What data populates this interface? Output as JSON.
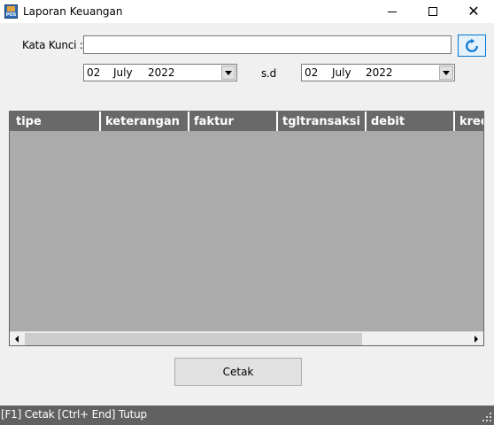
{
  "window": {
    "title": "Laporan Keuangan",
    "icon_text": "POS"
  },
  "form": {
    "keyword_label": "Kata Kunci :",
    "keyword_value": "",
    "sd_label": "s.d",
    "date_from": {
      "day": "02",
      "month": "July",
      "year": "2022"
    },
    "date_to": {
      "day": "02",
      "month": "July",
      "year": "2022"
    }
  },
  "grid": {
    "columns": [
      "tipe",
      "keterangan",
      "faktur",
      "tgltransaksi",
      "debit",
      "kredit"
    ],
    "rows": []
  },
  "actions": {
    "print_label": "Cetak"
  },
  "status": {
    "text": "[F1] Cetak  [Ctrl+ End] Tutup"
  },
  "colors": {
    "grid_header": "#696969",
    "grid_body": "#ababab",
    "status_bar": "#616161",
    "refresh_accent": "#0078d7"
  }
}
